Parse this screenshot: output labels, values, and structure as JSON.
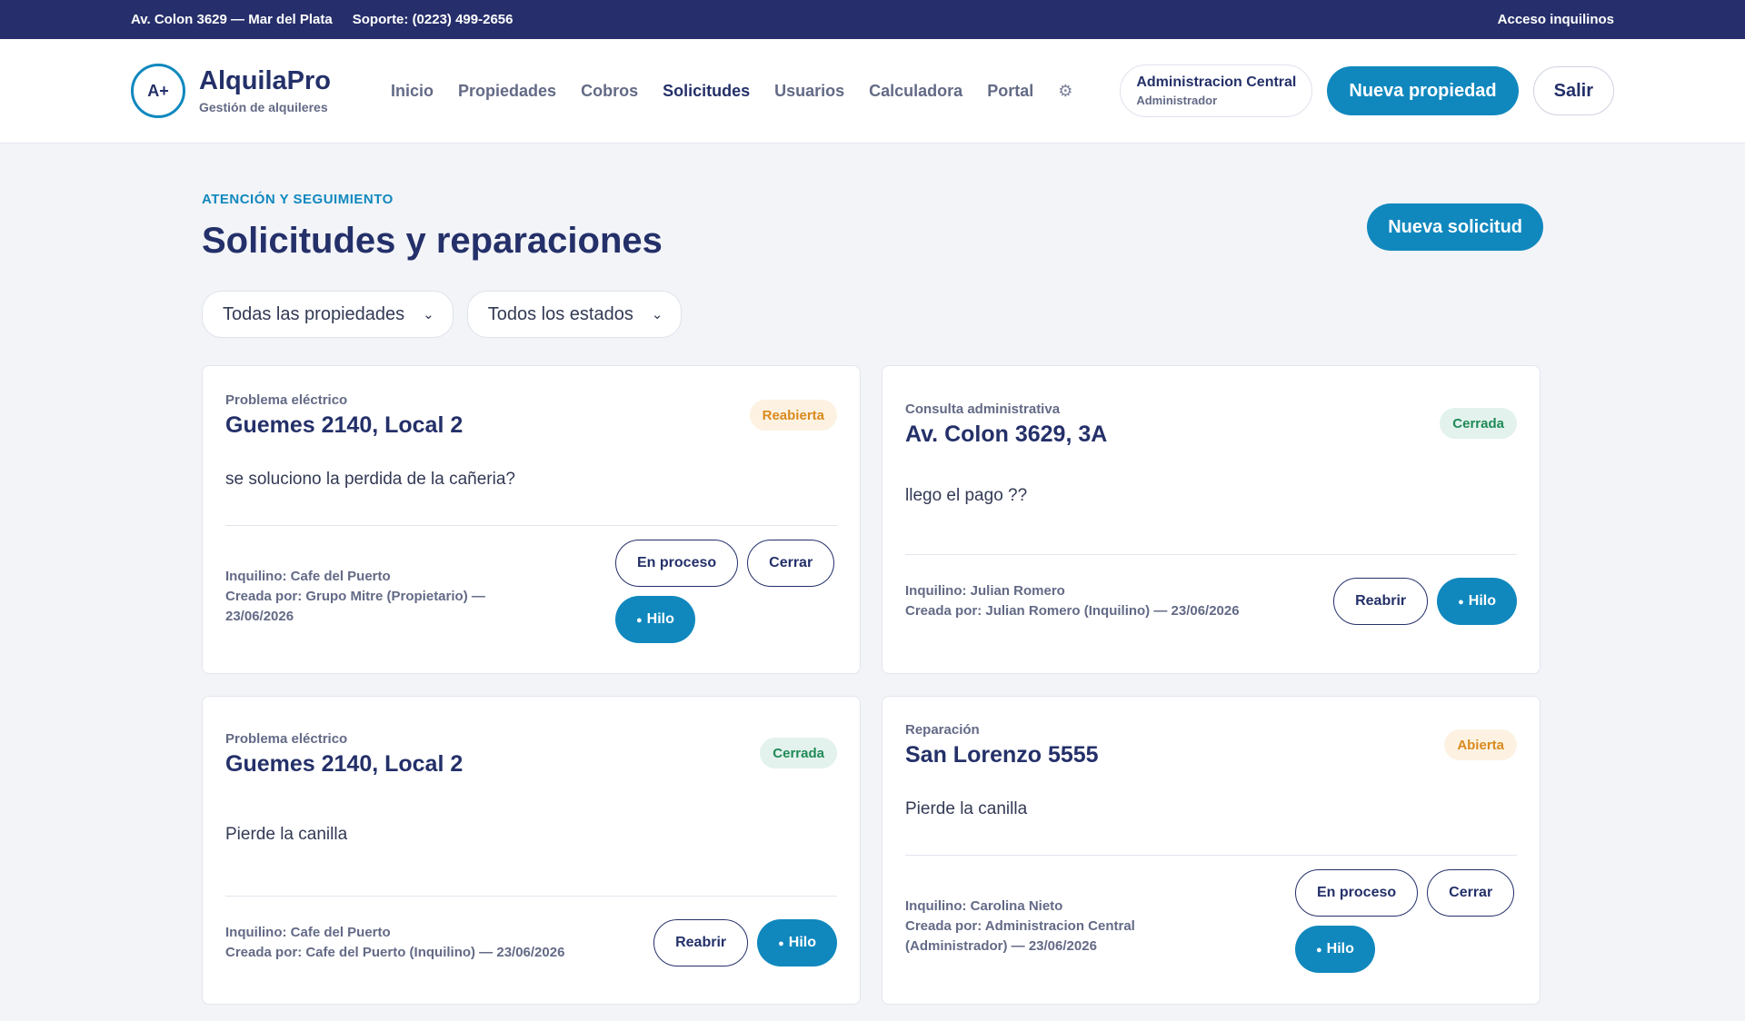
{
  "topbar": {
    "address": "Av. Colon 3629 — Mar del Plata",
    "support": "Soporte: (0223) 499-2656",
    "tenant_access": "Acceso inquilinos"
  },
  "brand": {
    "badge": "A+",
    "name": "AlquilaPro",
    "subtitle": "Gestión de alquileres"
  },
  "nav": {
    "items": [
      {
        "label": "Inicio"
      },
      {
        "label": "Propiedades"
      },
      {
        "label": "Cobros"
      },
      {
        "label": "Solicitudes",
        "active": true
      },
      {
        "label": "Usuarios"
      },
      {
        "label": "Calculadora"
      },
      {
        "label": "Portal"
      }
    ],
    "settings_icon": "⚙"
  },
  "user": {
    "name": "Administracion Central",
    "role": "Administrador"
  },
  "header_buttons": {
    "new_property": "Nueva propiedad",
    "logout": "Salir"
  },
  "page": {
    "eyebrow": "ATENCIÓN Y SEGUIMIENTO",
    "title": "Solicitudes y reparaciones",
    "new_request": "Nueva solicitud"
  },
  "filters": {
    "property": "Todas las propiedades",
    "status": "Todos los estados"
  },
  "cards": [
    {
      "category": "Problema eléctrico",
      "address": "Guemes 2140, Local 2",
      "status": "Reabierta",
      "message": "se soluciono la perdida de la cañeria?",
      "tenant": "Inquilino: Cafe del Puerto",
      "created_line1": "Creada por: Grupo Mitre (Propietario) —",
      "created_line2": "23/06/2026",
      "actions": [
        "En proceso",
        "Cerrar",
        "Hilo"
      ]
    },
    {
      "category": "Consulta administrativa",
      "address": "Av. Colon 3629, 3A",
      "status": "Cerrada",
      "message": "llego el pago ??",
      "tenant": "Inquilino: Julian Romero",
      "created_line1": "Creada por: Julian Romero (Inquilino) — 23/06/2026",
      "actions": [
        "Reabrir",
        "Hilo"
      ]
    },
    {
      "category": "Problema eléctrico",
      "address": "Guemes 2140, Local 2",
      "status": "Cerrada",
      "message": "Pierde la canilla",
      "tenant": "Inquilino: Cafe del Puerto",
      "created_line1": "Creada por: Cafe del Puerto (Inquilino) — 23/06/2026",
      "actions": [
        "Reabrir",
        "Hilo"
      ]
    },
    {
      "category": "Reparación",
      "address": "San Lorenzo 5555",
      "status": "Abierta",
      "message": "Pierde la canilla",
      "tenant": "Inquilino: Carolina Nieto",
      "created_line1": "Creada por: Administracion Central",
      "created_line2": "(Administrador) — 23/06/2026",
      "actions": [
        "En proceso",
        "Cerrar",
        "Hilo"
      ]
    }
  ],
  "colors": {
    "navy": "#262f6b",
    "primary": "#1088be",
    "badge_warn_text": "#d98a1e",
    "badge_ok_text": "#1f8a58"
  }
}
